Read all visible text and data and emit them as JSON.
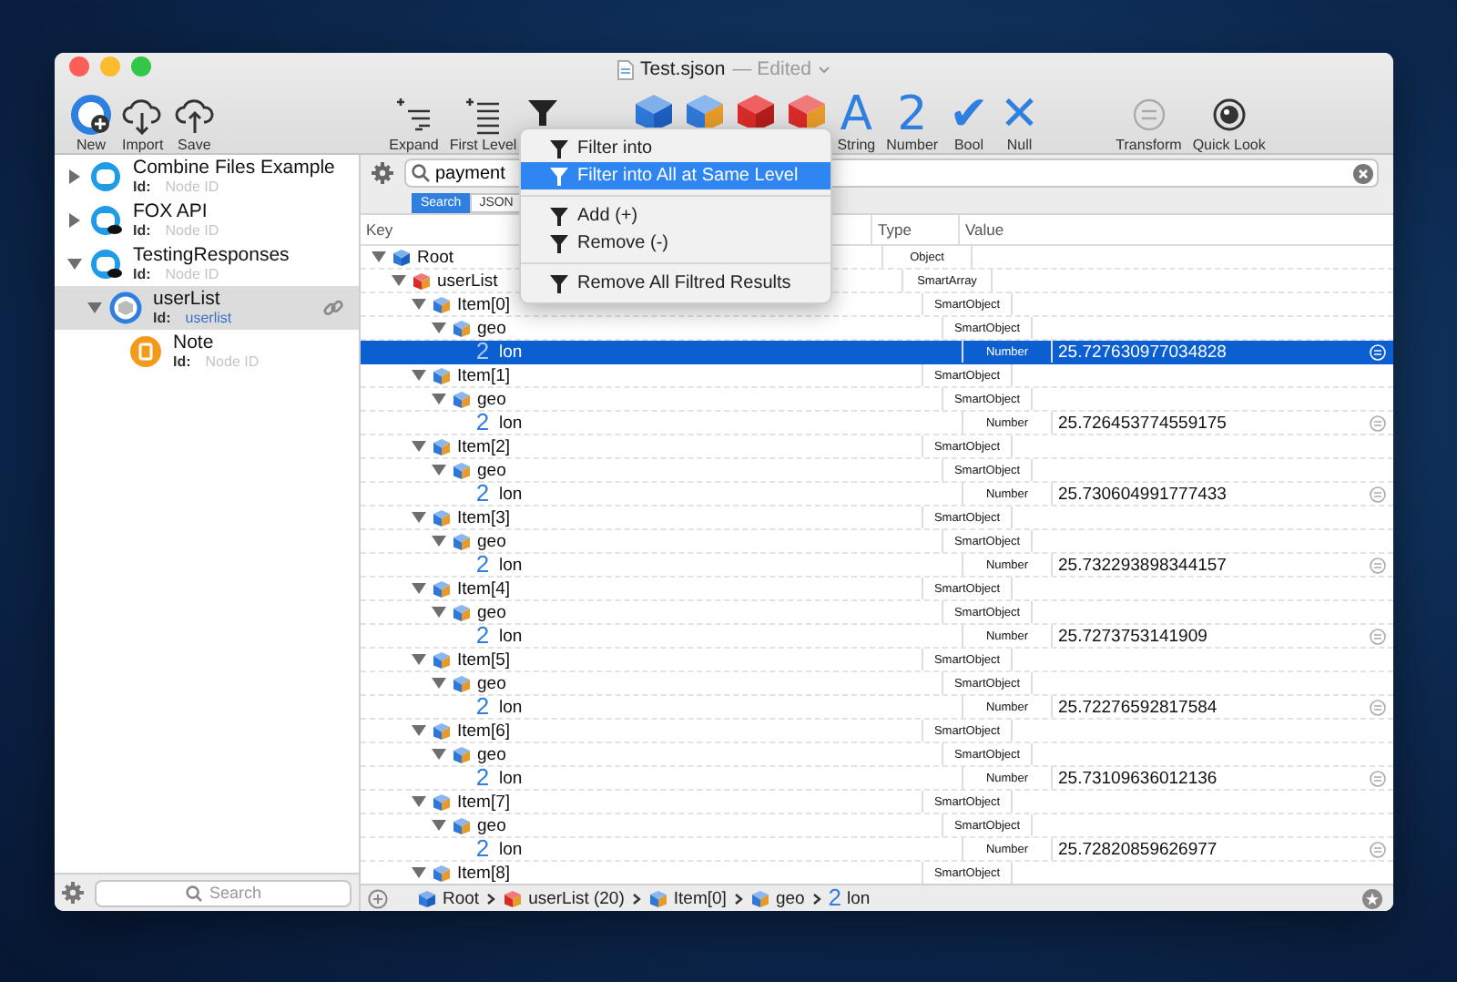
{
  "window": {
    "title": "Test.sjson",
    "status": "— Edited"
  },
  "toolbar": [
    {
      "label": "New",
      "kind": "new"
    },
    {
      "label": "Import",
      "kind": "import"
    },
    {
      "label": "Save",
      "kind": "save"
    },
    {
      "kind": "gap"
    },
    {
      "label": "Expand",
      "kind": "expand"
    },
    {
      "label": "First Level",
      "kind": "firstlevel"
    },
    {
      "kind": "filter"
    },
    {
      "kind": "gap"
    },
    {
      "kind": "object"
    },
    {
      "kind": "smartobject"
    },
    {
      "kind": "array"
    },
    {
      "kind": "smartarray"
    },
    {
      "label": "String",
      "kind": "glyph",
      "glyph": "A"
    },
    {
      "label": "Number",
      "kind": "glyph",
      "glyph": "2"
    },
    {
      "label": "Bool",
      "kind": "glyph",
      "glyph": "✔"
    },
    {
      "label": "Null",
      "kind": "glyph",
      "glyph": "✕"
    },
    {
      "kind": "gap"
    },
    {
      "label": "Transform",
      "kind": "transform"
    },
    {
      "label": "Quick Look",
      "kind": "quicklook"
    }
  ],
  "sidebar": {
    "items": [
      {
        "name": "Combine Files Example",
        "id_label": "Id:",
        "id": "Node ID",
        "kind": "service",
        "selected": false,
        "expanded": false
      },
      {
        "name": "FOX API",
        "id_label": "Id:",
        "id": "Node ID",
        "kind": "cloud",
        "selected": false,
        "expanded": false
      },
      {
        "name": "TestingResponses",
        "id_label": "Id:",
        "id": "Node ID",
        "kind": "cloud",
        "selected": false,
        "expanded": true,
        "children": [
          {
            "name": "userList",
            "id_label": "Id:",
            "id": "userlist",
            "kind": "list",
            "selected": true,
            "expanded": true,
            "children": [
              {
                "name": "Note",
                "id_label": "Id:",
                "id": "Node ID",
                "kind": "note",
                "selected": false
              }
            ]
          }
        ]
      }
    ],
    "search": {
      "placeholder": "Search"
    }
  },
  "search": {
    "value": "payment",
    "modes": [
      {
        "label": "Search",
        "selected": true
      },
      {
        "label": "JSON",
        "selected": false
      }
    ]
  },
  "filter_menu": [
    {
      "label": "Filter into",
      "kind": "item",
      "selected": false
    },
    {
      "label": "Filter into All at Same Level",
      "kind": "item",
      "selected": true
    },
    {
      "kind": "separator"
    },
    {
      "label": "Add (+)",
      "kind": "item",
      "selected": false
    },
    {
      "label": "Remove (-)",
      "kind": "item",
      "selected": false
    },
    {
      "kind": "separator"
    },
    {
      "label": "Remove All Filtred Results",
      "kind": "item",
      "selected": false
    }
  ],
  "tree": {
    "columns": [
      "Key",
      "Type",
      "Value"
    ],
    "rows": [
      {
        "key": "Root",
        "type": "Object",
        "kind": "object",
        "expanded": true,
        "selected": false,
        "children": [
          {
            "key": "userList",
            "type": "SmartArray",
            "kind": "smartarray",
            "expanded": true,
            "selected": false,
            "children": [
              {
                "key": "Item[0]",
                "type": "SmartObject",
                "kind": "smartobject",
                "expanded": true,
                "selected": false,
                "children": [
                  {
                    "key": "geo",
                    "type": "SmartObject",
                    "kind": "smartobject",
                    "expanded": true,
                    "selected": false,
                    "children": [
                      {
                        "key": "lon",
                        "type": "Number",
                        "kind": "number",
                        "glyph": "2",
                        "value": "25.727630977034828",
                        "selected": true
                      }
                    ]
                  }
                ]
              },
              {
                "key": "Item[1]",
                "type": "SmartObject",
                "kind": "smartobject",
                "expanded": true,
                "selected": false,
                "children": [
                  {
                    "key": "geo",
                    "type": "SmartObject",
                    "kind": "smartobject",
                    "expanded": true,
                    "selected": false,
                    "children": [
                      {
                        "key": "lon",
                        "type": "Number",
                        "kind": "number",
                        "glyph": "2",
                        "value": "25.726453774559175",
                        "selected": false
                      }
                    ]
                  }
                ]
              },
              {
                "key": "Item[2]",
                "type": "SmartObject",
                "kind": "smartobject",
                "expanded": true,
                "selected": false,
                "children": [
                  {
                    "key": "geo",
                    "type": "SmartObject",
                    "kind": "smartobject",
                    "expanded": true,
                    "selected": false,
                    "children": [
                      {
                        "key": "lon",
                        "type": "Number",
                        "kind": "number",
                        "glyph": "2",
                        "value": "25.730604991777433",
                        "selected": false
                      }
                    ]
                  }
                ]
              },
              {
                "key": "Item[3]",
                "type": "SmartObject",
                "kind": "smartobject",
                "expanded": true,
                "selected": false,
                "children": [
                  {
                    "key": "geo",
                    "type": "SmartObject",
                    "kind": "smartobject",
                    "expanded": true,
                    "selected": false,
                    "children": [
                      {
                        "key": "lon",
                        "type": "Number",
                        "kind": "number",
                        "glyph": "2",
                        "value": "25.732293898344157",
                        "selected": false
                      }
                    ]
                  }
                ]
              },
              {
                "key": "Item[4]",
                "type": "SmartObject",
                "kind": "smartobject",
                "expanded": true,
                "selected": false,
                "children": [
                  {
                    "key": "geo",
                    "type": "SmartObject",
                    "kind": "smartobject",
                    "expanded": true,
                    "selected": false,
                    "children": [
                      {
                        "key": "lon",
                        "type": "Number",
                        "kind": "number",
                        "glyph": "2",
                        "value": "25.7273753141909",
                        "selected": false
                      }
                    ]
                  }
                ]
              },
              {
                "key": "Item[5]",
                "type": "SmartObject",
                "kind": "smartobject",
                "expanded": true,
                "selected": false,
                "children": [
                  {
                    "key": "geo",
                    "type": "SmartObject",
                    "kind": "smartobject",
                    "expanded": true,
                    "selected": false,
                    "children": [
                      {
                        "key": "lon",
                        "type": "Number",
                        "kind": "number",
                        "glyph": "2",
                        "value": "25.72276592817584",
                        "selected": false
                      }
                    ]
                  }
                ]
              },
              {
                "key": "Item[6]",
                "type": "SmartObject",
                "kind": "smartobject",
                "expanded": true,
                "selected": false,
                "children": [
                  {
                    "key": "geo",
                    "type": "SmartObject",
                    "kind": "smartobject",
                    "expanded": true,
                    "selected": false,
                    "children": [
                      {
                        "key": "lon",
                        "type": "Number",
                        "kind": "number",
                        "glyph": "2",
                        "value": "25.73109636012136",
                        "selected": false
                      }
                    ]
                  }
                ]
              },
              {
                "key": "Item[7]",
                "type": "SmartObject",
                "kind": "smartobject",
                "expanded": true,
                "selected": false,
                "children": [
                  {
                    "key": "geo",
                    "type": "SmartObject",
                    "kind": "smartobject",
                    "expanded": true,
                    "selected": false,
                    "children": [
                      {
                        "key": "lon",
                        "type": "Number",
                        "kind": "number",
                        "glyph": "2",
                        "value": "25.72820859626977",
                        "selected": false
                      }
                    ]
                  }
                ]
              },
              {
                "key": "Item[8]",
                "type": "SmartObject",
                "kind": "smartobject",
                "expanded": true,
                "selected": false
              }
            ]
          }
        ]
      }
    ]
  },
  "breadcrumb": [
    {
      "label": "Root",
      "kind": "object"
    },
    {
      "label": "userList (20)",
      "kind": "smartarray"
    },
    {
      "label": "Item[0]",
      "kind": "smartobject"
    },
    {
      "label": "geo",
      "kind": "smartobject"
    },
    {
      "label": "lon",
      "kind": "number",
      "glyph": "2"
    }
  ]
}
